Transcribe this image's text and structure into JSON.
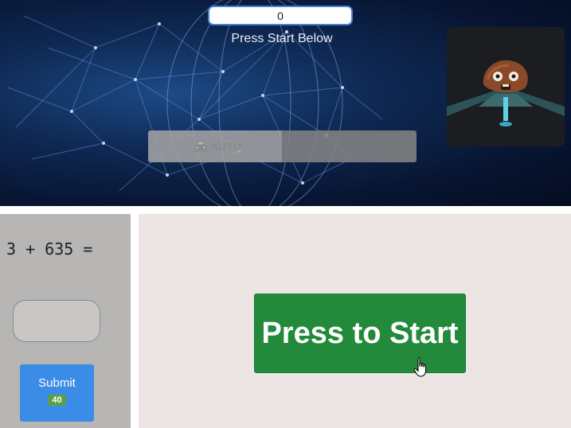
{
  "header": {
    "score_value": "0",
    "instruction": "Press Start Below",
    "mode_label": "AUTO",
    "mode_icon": "car-icon"
  },
  "quiz": {
    "equation": "3 + 635 =",
    "answer_value": "",
    "submit_label": "Submit",
    "submit_badge": "40"
  },
  "main": {
    "start_label": "Press to Start"
  },
  "colors": {
    "banner_bg": "#0f2a55",
    "start_button": "#228a3a",
    "submit_button": "#3b8ce6",
    "badge": "#5aa04a",
    "left_panel": "#b8b6b4",
    "right_panel": "#ede4e4"
  }
}
